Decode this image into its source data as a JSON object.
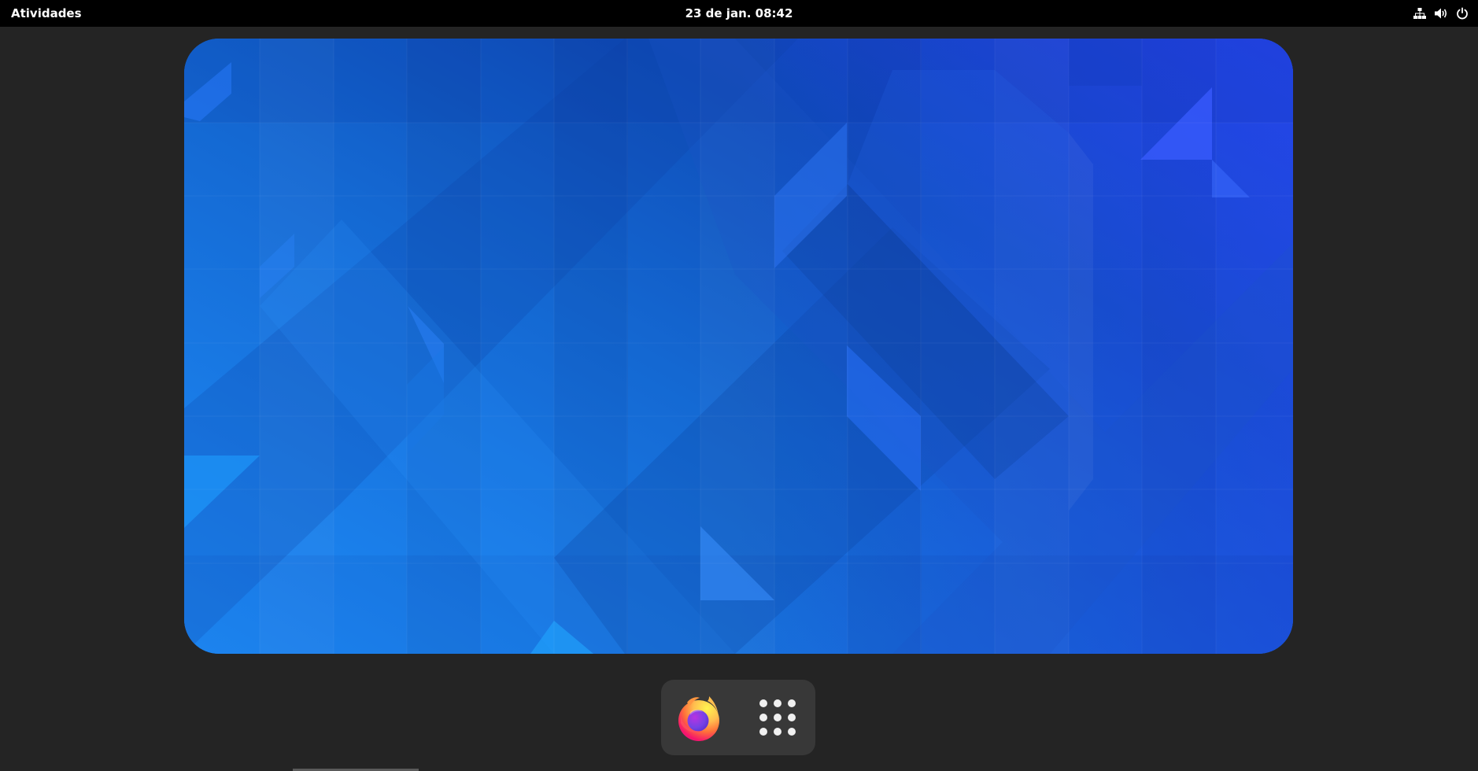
{
  "topbar": {
    "activities_label": "Atividades",
    "clock": "23 de jan. 08:42",
    "status_icons": [
      "network-wired-icon",
      "volume-icon",
      "power-icon"
    ]
  },
  "workspace": {
    "wallpaper": "blue-geometric-triangles"
  },
  "dash": {
    "items": [
      {
        "name": "Firefox",
        "icon": "firefox-icon"
      },
      {
        "name": "Show Applications",
        "icon": "app-grid-icon"
      }
    ]
  },
  "colors": {
    "topbar_bg": "#000000",
    "overview_bg": "#242424",
    "dash_bg": "#383838",
    "wallpaper_light": "#1e8cf8",
    "wallpaper_dark": "#0d4eb0",
    "wallpaper_violet": "#2340e0"
  }
}
